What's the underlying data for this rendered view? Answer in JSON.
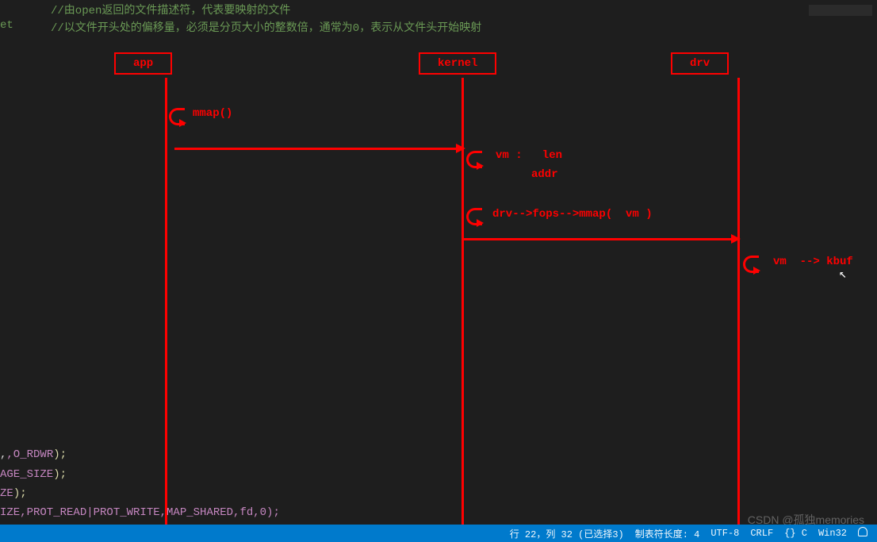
{
  "editor": {
    "gutter_et": "et",
    "comment1": "//由open返回的文件描述符，代表要映射的文件",
    "comment2": "//以文件开头处的偏移量，必须是分页大小的整数倍，通常为0，表示从文件头开始映射",
    "code_lines": {
      "l1_prefix": ",O_RDWR",
      "l1_suffix": ");",
      "l2_prefix": "AGE_SIZE",
      "l2_suffix": ");",
      "l3_prefix": "ZE",
      "l3_suffix": ");",
      "l4": "IZE,PROT_READ|PROT_WRITE,MAP_SHARED,fd,0);"
    }
  },
  "diagram": {
    "boxes": {
      "app": "app",
      "kernel": "kernel",
      "drv": "drv"
    },
    "labels": {
      "mmap": "mmap()",
      "vm_len": "vm :   len",
      "addr": "addr",
      "drv_fops": "drv-->fops-->mmap(  vm )",
      "vm_kbuf": "vm  --> kbuf"
    }
  },
  "status": {
    "position": "行 22，列 32 (已选择3)",
    "tabsize": "制表符长度: 4",
    "encoding": "UTF-8",
    "eol": "CRLF",
    "lang": "{} C",
    "platform": "Win32"
  },
  "watermark": "CSDN @孤独memories"
}
